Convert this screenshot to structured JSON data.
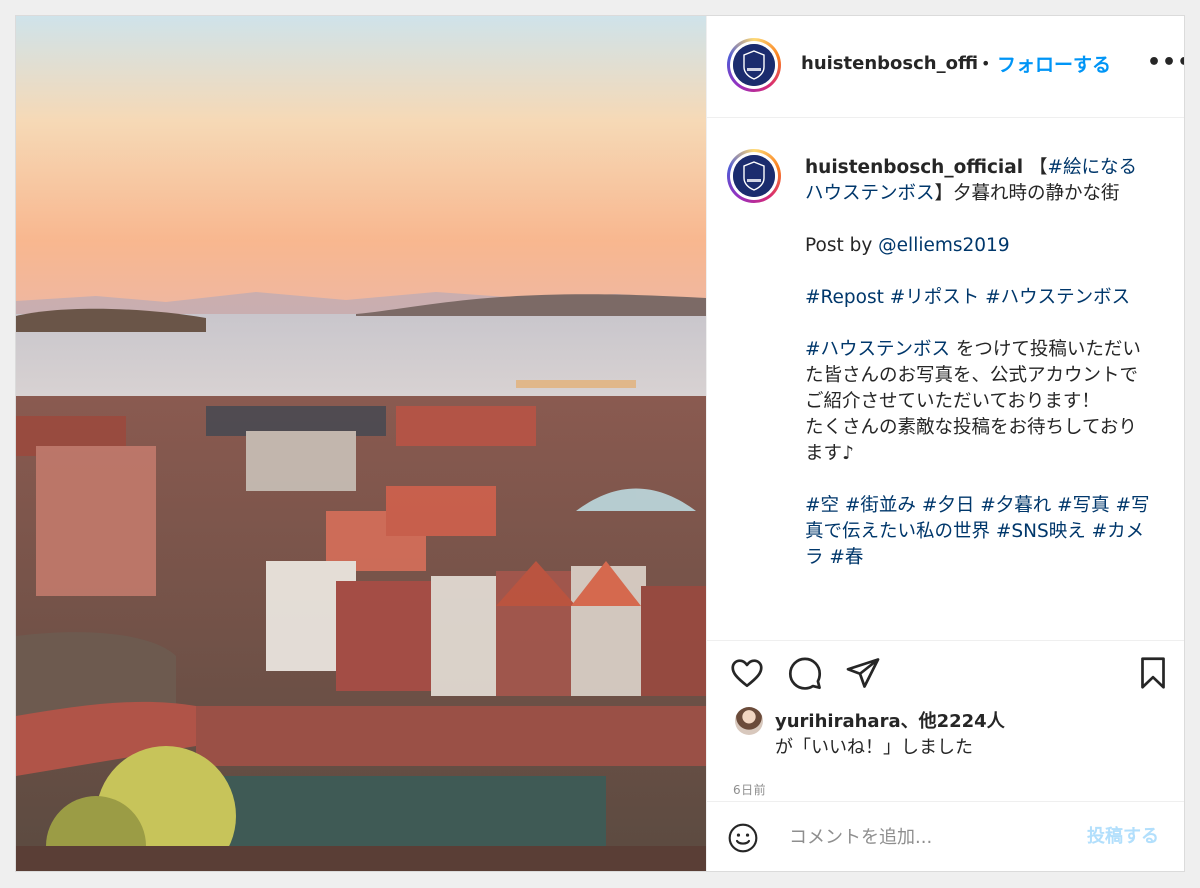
{
  "header": {
    "username": "huistenbosch_official",
    "separator": "•",
    "follow_label": "フォローする",
    "more_label": "•••"
  },
  "caption": {
    "username": "huistenbosch_official",
    "title_open": " 【",
    "title_tag": "#絵になるハウステンボス",
    "title_rest": "】夕暮れ時の静かな街",
    "post_by_prefix": "Post by ",
    "post_by_user": "@elliems2019",
    "repost_tags": [
      "#Repost",
      "#リポスト",
      "#ハウステンボス"
    ],
    "invite_tag": "#ハウステンボス",
    "invite_text": " をつけて投稿いただいた皆さんのお写真を、公式アカウントでご紹介させていただいております！\nたくさんの素敵な投稿をお待ちしております♪",
    "tags": [
      "#空",
      "#街並み",
      "#夕日",
      "#夕暮れ",
      "#写真",
      "#写真で伝えたい私の世界",
      "#SNS映え",
      "#カメラ",
      "#春"
    ]
  },
  "actions": {
    "like_icon": "heart-icon",
    "comment_icon": "comment-icon",
    "share_icon": "paper-plane-icon",
    "save_icon": "bookmark-icon"
  },
  "likes": {
    "liker": "yurihirahara",
    "others": "、他2224人",
    "suffix": "が「いいね！」しました"
  },
  "timestamp": "6日前",
  "add_comment": {
    "placeholder": "コメントを追加...",
    "emoji_icon": "smiley-icon",
    "post_label": "投稿する"
  },
  "colors": {
    "link_blue": "#0095f6",
    "hashtag": "#00376b",
    "post_disabled": "#b2dffc",
    "muted": "#8e8e8e"
  }
}
